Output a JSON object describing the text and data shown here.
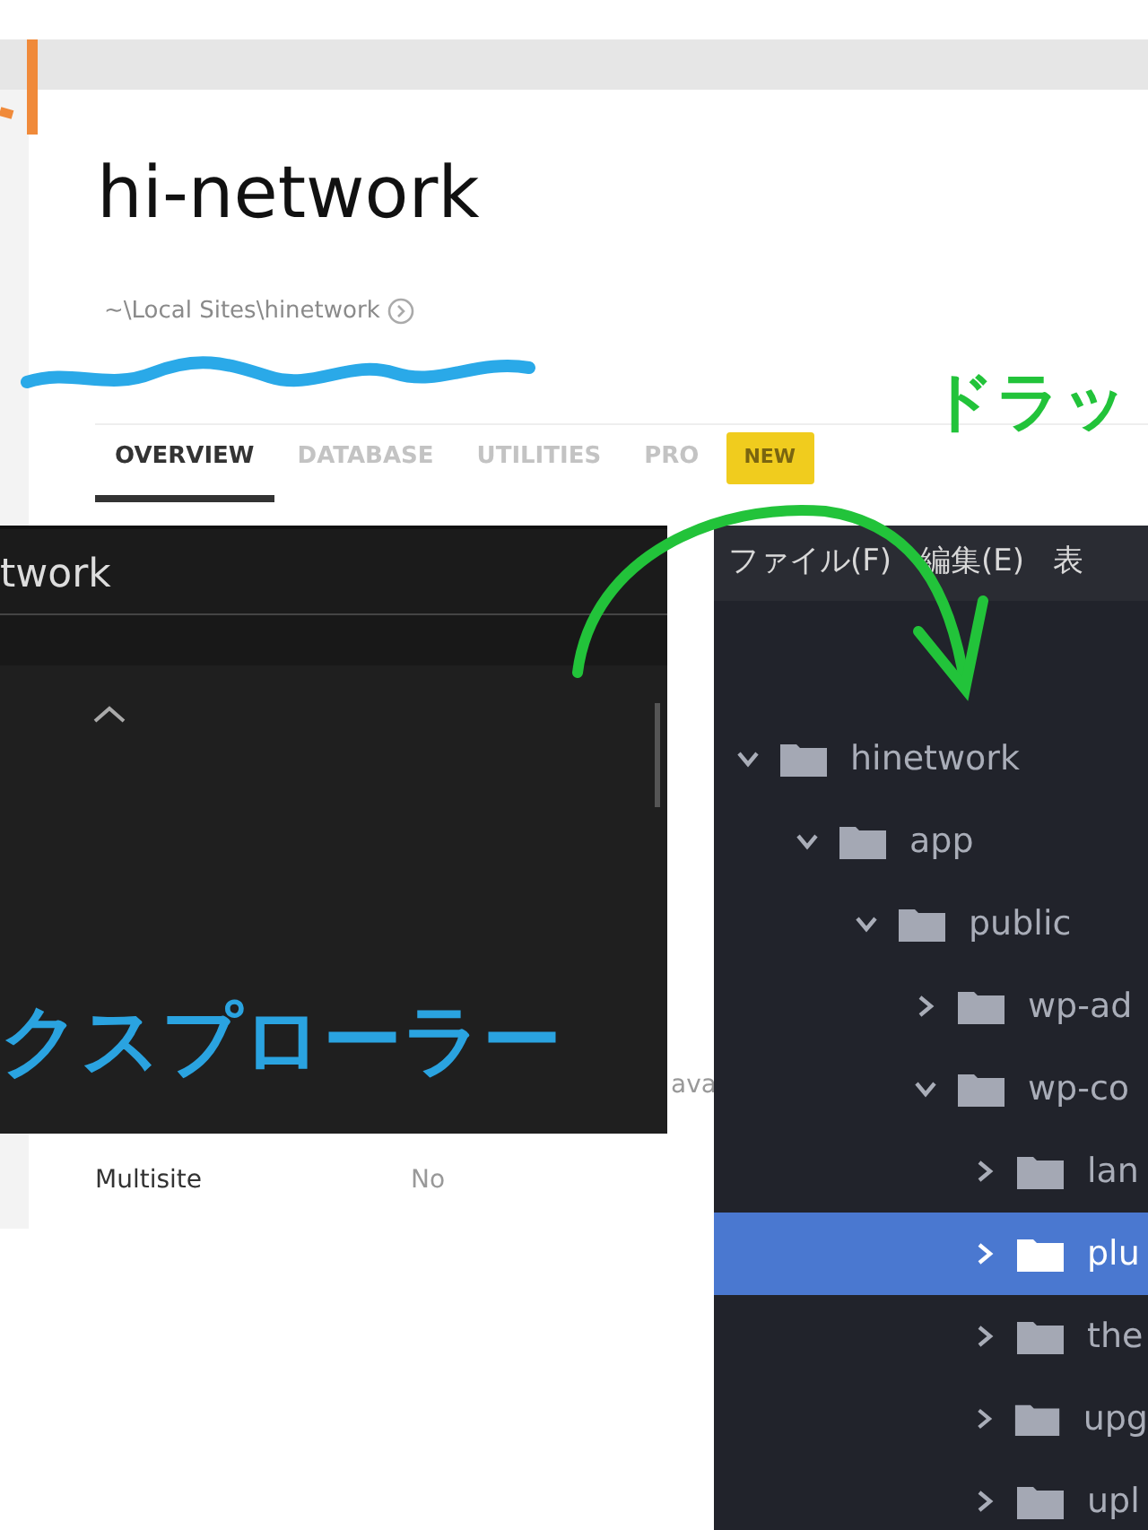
{
  "app_window": {
    "title": "hi-network",
    "path": "~\\Local Sites\\hinetwork",
    "tabs": [
      {
        "label": "OVERVIEW",
        "selected": true
      },
      {
        "label": "DATABASE",
        "selected": false
      },
      {
        "label": "UTILITIES",
        "selected": false
      },
      {
        "label": "PRO",
        "selected": false
      }
    ],
    "new_badge": "NEW",
    "partial_text": "ava",
    "rows": [
      {
        "label": "Multisite",
        "value": "No"
      }
    ]
  },
  "dark_window": {
    "title": "twork"
  },
  "explorer": {
    "menu": [
      "ファイル(F)",
      "編集(E)",
      "表"
    ],
    "tree": [
      {
        "label": "hinetwork",
        "expanded": true,
        "selected": false,
        "children": [
          {
            "label": "app",
            "expanded": true,
            "selected": false,
            "children": [
              {
                "label": "public",
                "expanded": true,
                "selected": false,
                "children": [
                  {
                    "label": "wp-ad",
                    "expanded": false,
                    "selected": false
                  },
                  {
                    "label": "wp-co",
                    "expanded": true,
                    "selected": false,
                    "children": [
                      {
                        "label": "lan",
                        "expanded": false,
                        "selected": false
                      },
                      {
                        "label": "plu",
                        "expanded": false,
                        "selected": true
                      },
                      {
                        "label": "the",
                        "expanded": false,
                        "selected": false
                      },
                      {
                        "label": "upg",
                        "expanded": false,
                        "selected": false
                      },
                      {
                        "label": "upl",
                        "expanded": false,
                        "selected": false
                      }
                    ]
                  }
                ]
              }
            ]
          }
        ]
      }
    ]
  },
  "annotations": [
    {
      "kind": "drag",
      "text": "ドラッ",
      "color": "#22c33a"
    },
    {
      "kind": "explorer",
      "text": "クスプローラー",
      "color": "#2aa3e0"
    }
  ]
}
